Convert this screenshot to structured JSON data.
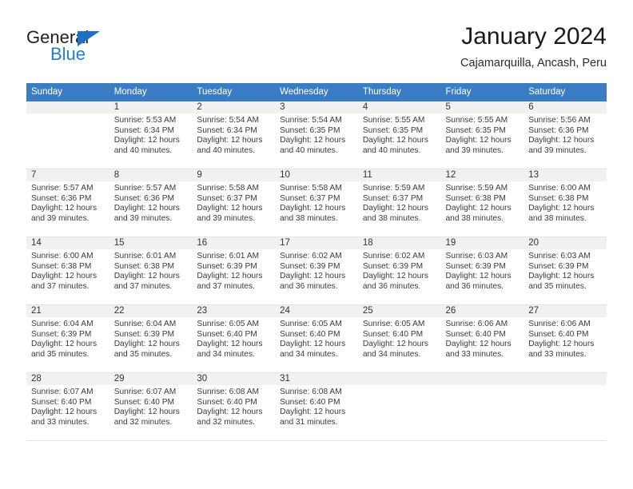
{
  "brand": {
    "name_part1": "General",
    "name_part2": "Blue",
    "triangle_color": "#1f6fc4",
    "blue_color": "#1f7fd0"
  },
  "header": {
    "title": "January 2024",
    "subtitle": "Cajamarquilla, Ancash, Peru"
  },
  "theme": {
    "header_row_bg": "#3b7dc4",
    "header_row_text": "#ffffff",
    "shaded_row_bg": "#f1f1f1",
    "cell_border": "#e3e3e3"
  },
  "weekday_headers": [
    "Sunday",
    "Monday",
    "Tuesday",
    "Wednesday",
    "Thursday",
    "Friday",
    "Saturday"
  ],
  "weeks": [
    {
      "shaded": true,
      "days": [
        {
          "num": "",
          "sunrise": "",
          "sunset": "",
          "daylight": ""
        },
        {
          "num": "1",
          "sunrise": "Sunrise: 5:53 AM",
          "sunset": "Sunset: 6:34 PM",
          "daylight": "Daylight: 12 hours and 40 minutes."
        },
        {
          "num": "2",
          "sunrise": "Sunrise: 5:54 AM",
          "sunset": "Sunset: 6:34 PM",
          "daylight": "Daylight: 12 hours and 40 minutes."
        },
        {
          "num": "3",
          "sunrise": "Sunrise: 5:54 AM",
          "sunset": "Sunset: 6:35 PM",
          "daylight": "Daylight: 12 hours and 40 minutes."
        },
        {
          "num": "4",
          "sunrise": "Sunrise: 5:55 AM",
          "sunset": "Sunset: 6:35 PM",
          "daylight": "Daylight: 12 hours and 40 minutes."
        },
        {
          "num": "5",
          "sunrise": "Sunrise: 5:55 AM",
          "sunset": "Sunset: 6:35 PM",
          "daylight": "Daylight: 12 hours and 39 minutes."
        },
        {
          "num": "6",
          "sunrise": "Sunrise: 5:56 AM",
          "sunset": "Sunset: 6:36 PM",
          "daylight": "Daylight: 12 hours and 39 minutes."
        }
      ]
    },
    {
      "shaded": true,
      "days": [
        {
          "num": "7",
          "sunrise": "Sunrise: 5:57 AM",
          "sunset": "Sunset: 6:36 PM",
          "daylight": "Daylight: 12 hours and 39 minutes."
        },
        {
          "num": "8",
          "sunrise": "Sunrise: 5:57 AM",
          "sunset": "Sunset: 6:36 PM",
          "daylight": "Daylight: 12 hours and 39 minutes."
        },
        {
          "num": "9",
          "sunrise": "Sunrise: 5:58 AM",
          "sunset": "Sunset: 6:37 PM",
          "daylight": "Daylight: 12 hours and 39 minutes."
        },
        {
          "num": "10",
          "sunrise": "Sunrise: 5:58 AM",
          "sunset": "Sunset: 6:37 PM",
          "daylight": "Daylight: 12 hours and 38 minutes."
        },
        {
          "num": "11",
          "sunrise": "Sunrise: 5:59 AM",
          "sunset": "Sunset: 6:37 PM",
          "daylight": "Daylight: 12 hours and 38 minutes."
        },
        {
          "num": "12",
          "sunrise": "Sunrise: 5:59 AM",
          "sunset": "Sunset: 6:38 PM",
          "daylight": "Daylight: 12 hours and 38 minutes."
        },
        {
          "num": "13",
          "sunrise": "Sunrise: 6:00 AM",
          "sunset": "Sunset: 6:38 PM",
          "daylight": "Daylight: 12 hours and 38 minutes."
        }
      ]
    },
    {
      "shaded": true,
      "days": [
        {
          "num": "14",
          "sunrise": "Sunrise: 6:00 AM",
          "sunset": "Sunset: 6:38 PM",
          "daylight": "Daylight: 12 hours and 37 minutes."
        },
        {
          "num": "15",
          "sunrise": "Sunrise: 6:01 AM",
          "sunset": "Sunset: 6:38 PM",
          "daylight": "Daylight: 12 hours and 37 minutes."
        },
        {
          "num": "16",
          "sunrise": "Sunrise: 6:01 AM",
          "sunset": "Sunset: 6:39 PM",
          "daylight": "Daylight: 12 hours and 37 minutes."
        },
        {
          "num": "17",
          "sunrise": "Sunrise: 6:02 AM",
          "sunset": "Sunset: 6:39 PM",
          "daylight": "Daylight: 12 hours and 36 minutes."
        },
        {
          "num": "18",
          "sunrise": "Sunrise: 6:02 AM",
          "sunset": "Sunset: 6:39 PM",
          "daylight": "Daylight: 12 hours and 36 minutes."
        },
        {
          "num": "19",
          "sunrise": "Sunrise: 6:03 AM",
          "sunset": "Sunset: 6:39 PM",
          "daylight": "Daylight: 12 hours and 36 minutes."
        },
        {
          "num": "20",
          "sunrise": "Sunrise: 6:03 AM",
          "sunset": "Sunset: 6:39 PM",
          "daylight": "Daylight: 12 hours and 35 minutes."
        }
      ]
    },
    {
      "shaded": true,
      "days": [
        {
          "num": "21",
          "sunrise": "Sunrise: 6:04 AM",
          "sunset": "Sunset: 6:39 PM",
          "daylight": "Daylight: 12 hours and 35 minutes."
        },
        {
          "num": "22",
          "sunrise": "Sunrise: 6:04 AM",
          "sunset": "Sunset: 6:39 PM",
          "daylight": "Daylight: 12 hours and 35 minutes."
        },
        {
          "num": "23",
          "sunrise": "Sunrise: 6:05 AM",
          "sunset": "Sunset: 6:40 PM",
          "daylight": "Daylight: 12 hours and 34 minutes."
        },
        {
          "num": "24",
          "sunrise": "Sunrise: 6:05 AM",
          "sunset": "Sunset: 6:40 PM",
          "daylight": "Daylight: 12 hours and 34 minutes."
        },
        {
          "num": "25",
          "sunrise": "Sunrise: 6:05 AM",
          "sunset": "Sunset: 6:40 PM",
          "daylight": "Daylight: 12 hours and 34 minutes."
        },
        {
          "num": "26",
          "sunrise": "Sunrise: 6:06 AM",
          "sunset": "Sunset: 6:40 PM",
          "daylight": "Daylight: 12 hours and 33 minutes."
        },
        {
          "num": "27",
          "sunrise": "Sunrise: 6:06 AM",
          "sunset": "Sunset: 6:40 PM",
          "daylight": "Daylight: 12 hours and 33 minutes."
        }
      ]
    },
    {
      "shaded": true,
      "days": [
        {
          "num": "28",
          "sunrise": "Sunrise: 6:07 AM",
          "sunset": "Sunset: 6:40 PM",
          "daylight": "Daylight: 12 hours and 33 minutes."
        },
        {
          "num": "29",
          "sunrise": "Sunrise: 6:07 AM",
          "sunset": "Sunset: 6:40 PM",
          "daylight": "Daylight: 12 hours and 32 minutes."
        },
        {
          "num": "30",
          "sunrise": "Sunrise: 6:08 AM",
          "sunset": "Sunset: 6:40 PM",
          "daylight": "Daylight: 12 hours and 32 minutes."
        },
        {
          "num": "31",
          "sunrise": "Sunrise: 6:08 AM",
          "sunset": "Sunset: 6:40 PM",
          "daylight": "Daylight: 12 hours and 31 minutes."
        },
        {
          "num": "",
          "sunrise": "",
          "sunset": "",
          "daylight": ""
        },
        {
          "num": "",
          "sunrise": "",
          "sunset": "",
          "daylight": ""
        },
        {
          "num": "",
          "sunrise": "",
          "sunset": "",
          "daylight": ""
        }
      ]
    }
  ]
}
